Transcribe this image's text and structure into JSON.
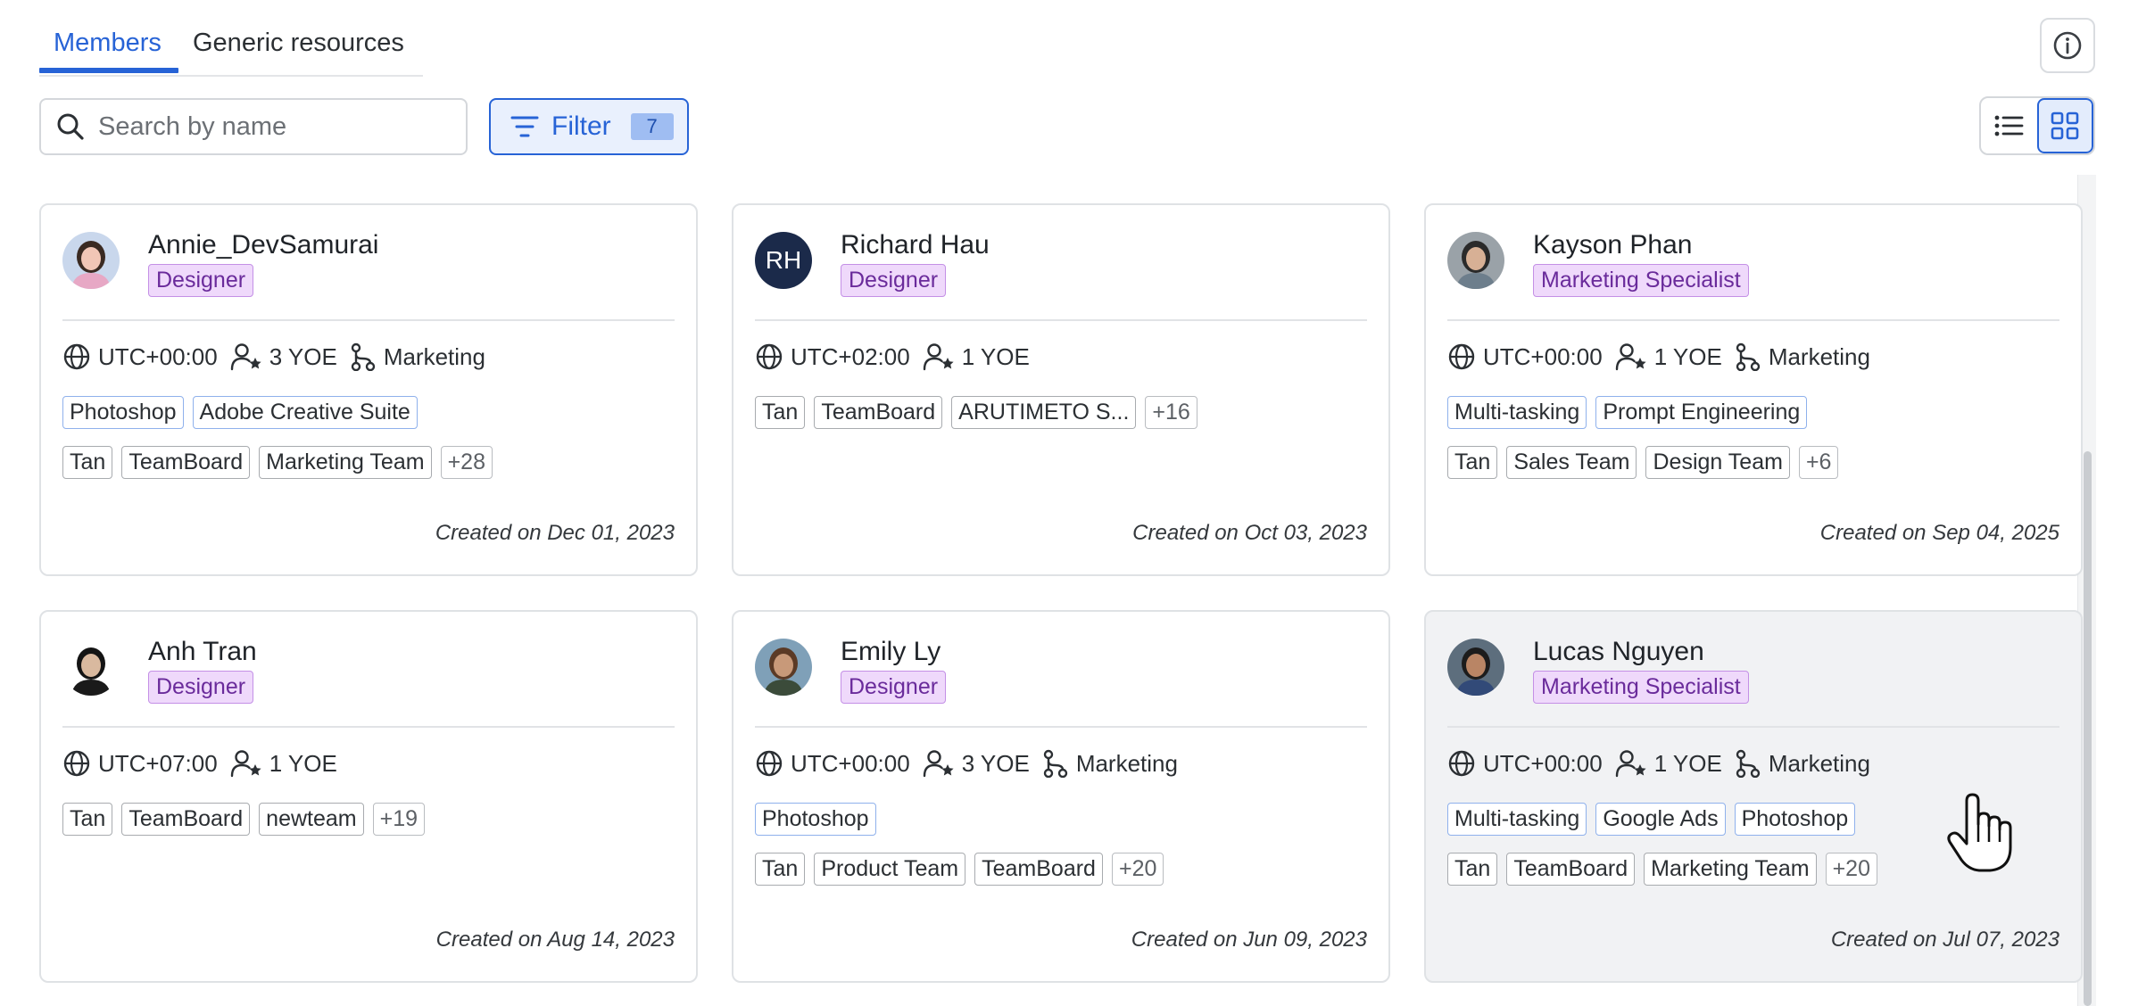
{
  "tabs": [
    {
      "label": "Members",
      "active": true
    },
    {
      "label": "Generic resources",
      "active": false
    }
  ],
  "search": {
    "placeholder": "Search by name",
    "value": ""
  },
  "filter": {
    "label": "Filter",
    "count": "7"
  },
  "view_modes": [
    "list",
    "grid"
  ],
  "active_view": "grid",
  "colors": {
    "accent": "#2763d6",
    "role_bg": "#efd9fb",
    "role_text": "#6a2b9b"
  },
  "members": [
    {
      "name": "Annie_DevSamurai",
      "role": "Designer",
      "avatar": "photo",
      "timezone": "UTC+00:00",
      "yoe": "3 YOE",
      "department": "Marketing",
      "skills": [
        "Photoshop",
        "Adobe Creative Suite"
      ],
      "teams": [
        "Tan",
        "TeamBoard",
        "Marketing Team"
      ],
      "teams_more": "+28",
      "created": "Created on Dec 01, 2023"
    },
    {
      "name": "Richard Hau",
      "role": "Designer",
      "avatar": "initials",
      "initials": "RH",
      "timezone": "UTC+02:00",
      "yoe": "1 YOE",
      "department": "",
      "skills": [],
      "teams": [
        "Tan",
        "TeamBoard",
        "ARUTIMETO S..."
      ],
      "teams_more": "+16",
      "created": "Created on Oct 03, 2023"
    },
    {
      "name": "Kayson Phan",
      "role": "Marketing Specialist",
      "avatar": "photo",
      "timezone": "UTC+00:00",
      "yoe": "1 YOE",
      "department": "Marketing",
      "skills": [
        "Multi-tasking",
        "Prompt Engineering"
      ],
      "teams": [
        "Tan",
        "Sales Team",
        "Design Team"
      ],
      "teams_more": "+6",
      "created": "Created on Sep 04, 2025"
    },
    {
      "name": "Anh Tran",
      "role": "Designer",
      "avatar": "photo",
      "timezone": "UTC+07:00",
      "yoe": "1 YOE",
      "department": "",
      "skills": [],
      "teams": [
        "Tan",
        "TeamBoard",
        "newteam"
      ],
      "teams_more": "+19",
      "created": "Created on Aug 14, 2023"
    },
    {
      "name": "Emily Ly",
      "role": "Designer",
      "avatar": "photo",
      "timezone": "UTC+00:00",
      "yoe": "3 YOE",
      "department": "Marketing",
      "skills": [
        "Photoshop"
      ],
      "teams": [
        "Tan",
        "Product Team",
        "TeamBoard"
      ],
      "teams_more": "+20",
      "created": "Created on Jun 09, 2023"
    },
    {
      "name": "Lucas Nguyen",
      "role": "Marketing Specialist",
      "avatar": "photo",
      "hovered": true,
      "timezone": "UTC+00:00",
      "yoe": "1 YOE",
      "department": "Marketing",
      "skills": [
        "Multi-tasking",
        "Google Ads",
        "Photoshop"
      ],
      "teams": [
        "Tan",
        "TeamBoard",
        "Marketing Team"
      ],
      "teams_more": "+20",
      "created": "Created on Jul 07, 2023"
    }
  ],
  "icons": {
    "info": "info-icon",
    "search": "search-icon",
    "filter": "filter-lines-icon",
    "list_view": "list-view-icon",
    "grid_view": "grid-view-icon",
    "timezone": "globe-icon",
    "yoe": "user-star-icon",
    "department": "branch-icon",
    "cursor": "hand-pointer-icon"
  }
}
